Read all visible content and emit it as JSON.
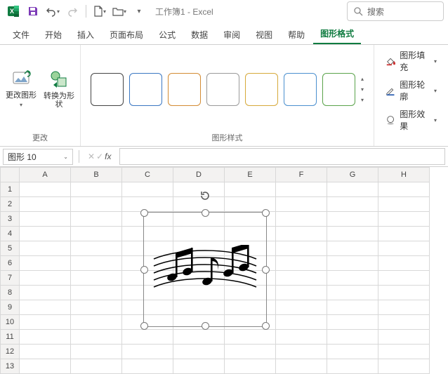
{
  "app": {
    "title": "工作簿1 - Excel"
  },
  "search": {
    "placeholder": "搜索"
  },
  "tabs": [
    "文件",
    "开始",
    "插入",
    "页面布局",
    "公式",
    "数据",
    "审阅",
    "视图",
    "帮助",
    "图形格式"
  ],
  "active_tab": 9,
  "ribbon": {
    "change_group": {
      "btn1": "更改图形",
      "btn2": "转换为形状",
      "label": "更改"
    },
    "styles_group": {
      "label": "图形样式"
    },
    "format_opts": {
      "fill": "图形填充",
      "outline": "图形轮廓",
      "effects": "图形效果"
    }
  },
  "namebox": {
    "value": "图形 10"
  },
  "fx": {
    "label": "fx"
  },
  "columns": [
    "A",
    "B",
    "C",
    "D",
    "E",
    "F",
    "G",
    "H"
  ],
  "rows": [
    1,
    2,
    3,
    4,
    5,
    6,
    7,
    8,
    9,
    10,
    11,
    12,
    13
  ],
  "style_colors": [
    "#444",
    "#3a77c2",
    "#d38b33",
    "#9a9a9a",
    "#d6a93a",
    "#4a8fcf",
    "#5aa34a"
  ]
}
